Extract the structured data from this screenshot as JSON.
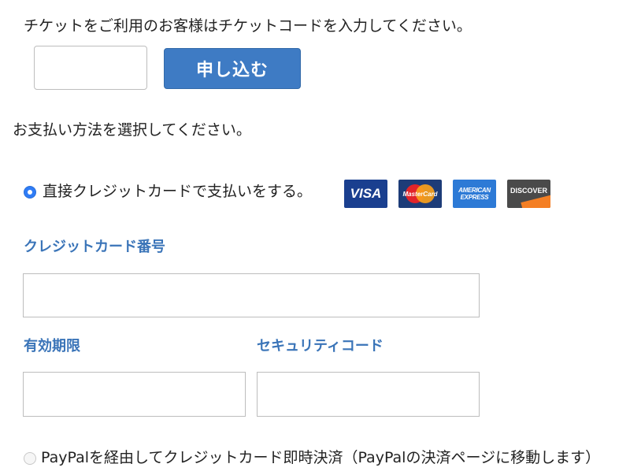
{
  "ticket": {
    "instruction": "チケットをご利用のお客様はチケットコードを入力してください。",
    "code_value": "",
    "apply_label": "申し込む"
  },
  "payment": {
    "heading": "お支払い方法を選択してください。",
    "options": [
      {
        "label": "直接クレジットカードで支払いをする。",
        "selected": true
      },
      {
        "label": "PayPalを経由してクレジットカード即時決済（PayPalの決済ページに移動します）",
        "selected": false
      }
    ],
    "card_logos": {
      "visa": "VISA",
      "mastercard": "MasterCard",
      "amex_line1": "AMERICAN",
      "amex_line2": "EXPRESS",
      "discover": "DISCOVER"
    },
    "fields": {
      "card_number_label": "クレジットカード番号",
      "card_number_value": "",
      "expiry_label": "有効期限",
      "expiry_value": "",
      "security_code_label": "セキュリティコード",
      "security_code_value": ""
    }
  },
  "colors": {
    "accent": "#3e7bc4",
    "field_label": "#3a74b8",
    "radio_selected": "#2f7cf6"
  }
}
